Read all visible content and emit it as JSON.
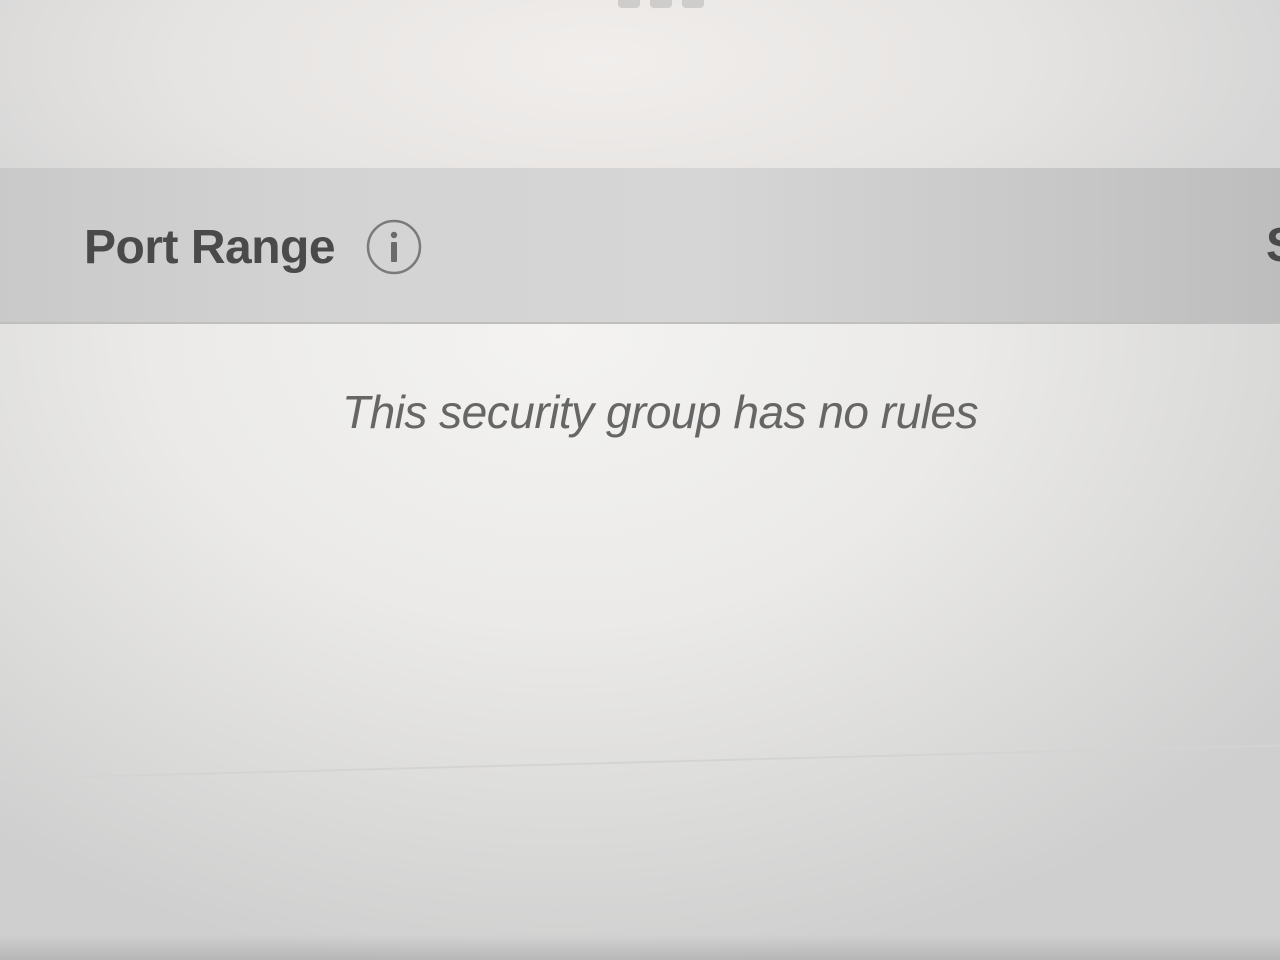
{
  "table": {
    "columns": [
      {
        "label": "Port Range",
        "icon": "info-icon"
      },
      {
        "label": "S"
      }
    ],
    "empty_message": "This security group has no rules"
  },
  "colors": {
    "header_background": "#d3d3d3",
    "header_text": "#4a4a4a",
    "empty_text": "#666666"
  }
}
